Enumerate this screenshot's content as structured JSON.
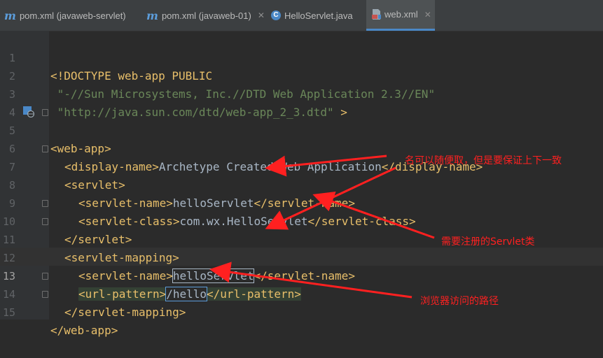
{
  "tabs": [
    {
      "label": "pom.xml (javaweb-servlet)",
      "icon": "maven-icon",
      "active": false
    },
    {
      "label": "pom.xml (javaweb-01)",
      "icon": "maven-icon",
      "active": false
    },
    {
      "label": "HelloServlet.java",
      "icon": "java-class-icon",
      "active": false
    },
    {
      "label": "web.xml",
      "icon": "xml-file-icon",
      "active": true
    }
  ],
  "tab_icon_glyph": {
    "maven": "m",
    "class": "C"
  },
  "close_glyph": "✕",
  "line_numbers": [
    "1",
    "2",
    "3",
    "4",
    "5",
    "6",
    "7",
    "8",
    "9",
    "10",
    "11",
    "12",
    "13",
    "14",
    "15"
  ],
  "current_line": "13",
  "code": {
    "l1": "<!DOCTYPE web-app PUBLIC",
    "l2": " \"-//Sun Microsystems, Inc.//DTD Web Application 2.3//EN\"",
    "l3_str": " \"http://java.sun.com/dtd/web-app_2_3.dtd\"",
    "l3_end": " >",
    "l5": "<web-app>",
    "l6_open": "<display-name>",
    "l6_text": "Archetype Created Web Application",
    "l6_close": "</display-name>",
    "l7": "<servlet>",
    "l8_open": "<servlet-name>",
    "l8_text": "helloServlet",
    "l8_close": "</servlet-name>",
    "l9_open": "<servlet-class>",
    "l9_text": "com.wx.HelloServlet",
    "l9_close": "</servlet-class>",
    "l10": "</servlet>",
    "l11": "<servlet-mapping>",
    "l12_open": "<servlet-name>",
    "l12_text": "helloServlet",
    "l12_close": "</servlet-name>",
    "l13_open": "<url-pattern>",
    "l13_text": "/hello",
    "l13_close": "</url-pattern>",
    "l14": "</servlet-mapping>",
    "l15": "</web-app>"
  },
  "annotations": {
    "name_note": "名可以随便取，但是要保证上下一致",
    "class_note": "需要注册的Servlet类",
    "url_note": "浏览器访问的路径"
  },
  "colors": {
    "background": "#2b2b2b",
    "tag": "#e8bf6a",
    "string": "#6a8759",
    "text": "#a9b7c6",
    "annotation": "#ff2020",
    "active_tab_underline": "#4a88c7"
  }
}
